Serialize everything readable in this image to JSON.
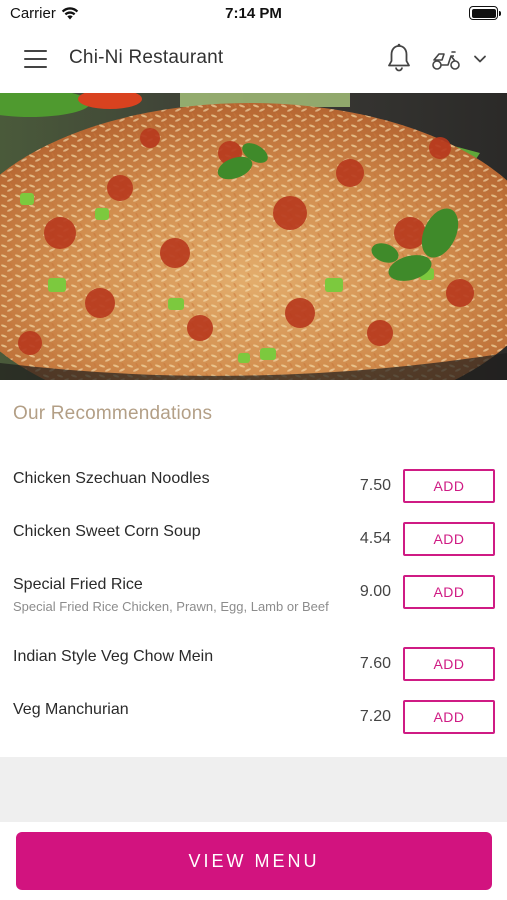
{
  "status_bar": {
    "carrier": "Carrier",
    "time": "7:14 PM"
  },
  "header": {
    "title": "Chi-Ni Restaurant",
    "icons": [
      "hamburger-menu-icon",
      "bell-icon",
      "scooter-icon",
      "chevron-down-icon"
    ]
  },
  "hero": {
    "image": "fried-rice-photo"
  },
  "recommendations": {
    "title": "Our Recommendations",
    "items": [
      {
        "name": "Chicken Szechuan Noodles",
        "description": "",
        "price": "7.50",
        "button": "ADD"
      },
      {
        "name": "Chicken Sweet Corn Soup",
        "description": "",
        "price": "4.54",
        "button": "ADD"
      },
      {
        "name": "Special Fried Rice",
        "description": "Special Fried Rice Chicken, Prawn, Egg, Lamb or Beef",
        "price": "9.00",
        "button": "ADD"
      },
      {
        "name": "Indian Style Veg Chow Mein",
        "description": "",
        "price": "7.60",
        "button": "ADD"
      },
      {
        "name": "Veg Manchurian",
        "description": "",
        "price": "7.20",
        "button": "ADD"
      }
    ]
  },
  "footer": {
    "view_menu_label": "VIEW MENU"
  },
  "colors": {
    "accent": "#d2137f",
    "section_title": "#b39f86",
    "band": "#efefef"
  }
}
